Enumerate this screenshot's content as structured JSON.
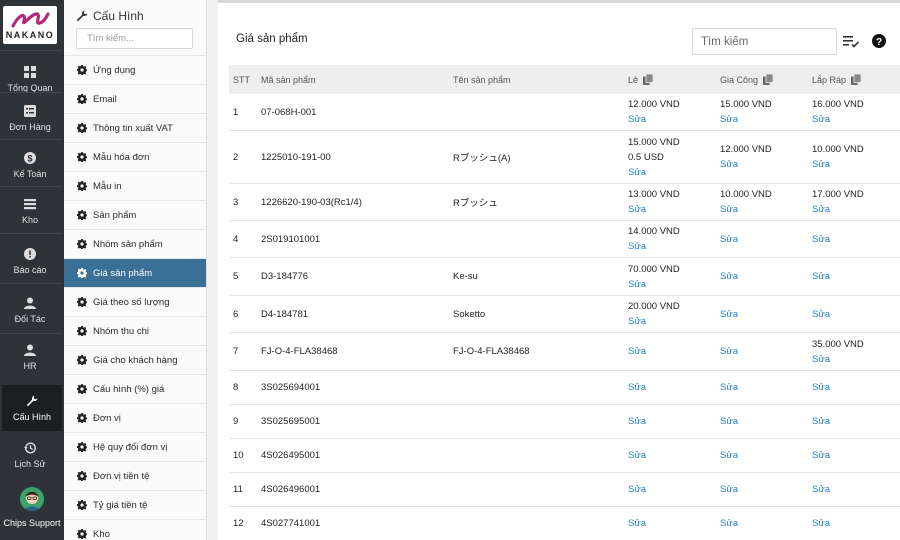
{
  "brand": {
    "logo_text": "NAKANO",
    "logo_color": "#b2287a"
  },
  "rail": [
    {
      "label": "Tổng Quan",
      "icon": "grid-icon"
    },
    {
      "label": "Đơn Hàng",
      "icon": "list-icon"
    },
    {
      "label": "Kế Toán",
      "icon": "dollar-icon"
    },
    {
      "label": "Kho",
      "icon": "stack-icon"
    },
    {
      "label": "Báo cáo",
      "icon": "alert-icon"
    },
    {
      "label": "Đối Tác",
      "icon": "person-icon"
    },
    {
      "label": "HR",
      "icon": "person-icon"
    },
    {
      "label": "Cấu Hình",
      "icon": "wrench-icon"
    },
    {
      "label": "Lịch Sử",
      "icon": "history-icon"
    }
  ],
  "chips": {
    "label": "Chips Support"
  },
  "sidebar": {
    "title": "Cấu Hình",
    "search_placeholder": "Tìm kiếm...",
    "items": [
      "Ứng dụng",
      "Email",
      "Thông tin xuất VAT",
      "Mẫu hóa đơn",
      "Mẫu in",
      "Sản phẩm",
      "Nhóm sản phẩm",
      "Giá sản phẩm",
      "Giá theo số lượng",
      "Nhóm thu chi",
      "Giá cho khách hàng",
      "Cấu hình (%) giá",
      "Đơn vị",
      "Hệ quy đổi đơn vị",
      "Đơn vị tiền tệ",
      "Tỷ giá tiền tệ",
      "Kho"
    ],
    "active_index": 7
  },
  "main": {
    "title": "Giá sản phẩm",
    "search_placeholder": "Tìm kiếm"
  },
  "table": {
    "headers": {
      "stt": "STT",
      "code": "Mã sản phẩm",
      "name": "Tên sản phẩm",
      "le": "Lẻ",
      "gc": "Gia Công",
      "lr": "Lắp Ráp"
    },
    "edit_label": "Sửa",
    "rows": [
      {
        "stt": "1",
        "code": "07-068H-001",
        "name": "",
        "le": [
          "12.000 VND"
        ],
        "gc": [
          "15.000 VND"
        ],
        "lr": [
          "16.000 VND"
        ]
      },
      {
        "stt": "2",
        "code": "1225010-191-00",
        "name": "Rブッシュ(A)",
        "le": [
          "15.000 VND",
          "0.5 USD"
        ],
        "gc": [
          "12.000 VND"
        ],
        "lr": [
          "10.000 VND"
        ]
      },
      {
        "stt": "3",
        "code": "1226620-190-03(Rc1/4)",
        "name": "Rブッシュ",
        "le": [
          "13.000 VND"
        ],
        "gc": [
          "10.000 VND"
        ],
        "lr": [
          "17.000 VND"
        ]
      },
      {
        "stt": "4",
        "code": "2S019101001",
        "name": "",
        "le": [
          "14.000 VND"
        ],
        "gc": [],
        "lr": []
      },
      {
        "stt": "5",
        "code": "D3-184776",
        "name": "Ke-su",
        "le": [
          "70.000 VND"
        ],
        "gc": [],
        "lr": []
      },
      {
        "stt": "6",
        "code": "D4-184781",
        "name": "Soketto",
        "le": [
          "20.000 VND"
        ],
        "gc": [],
        "lr": []
      },
      {
        "stt": "7",
        "code": "FJ-O-4-FLA38468",
        "name": "FJ-O-4-FLA38468",
        "le": [],
        "gc": [],
        "lr": [
          "35.000 VND"
        ]
      },
      {
        "stt": "8",
        "code": "3S025694001",
        "name": "",
        "le": [],
        "gc": [],
        "lr": []
      },
      {
        "stt": "9",
        "code": "3S025695001",
        "name": "",
        "le": [],
        "gc": [],
        "lr": []
      },
      {
        "stt": "10",
        "code": "4S026495001",
        "name": "",
        "le": [],
        "gc": [],
        "lr": []
      },
      {
        "stt": "11",
        "code": "4S026496001",
        "name": "",
        "le": [],
        "gc": [],
        "lr": []
      },
      {
        "stt": "12",
        "code": "4S027741001",
        "name": "",
        "le": [],
        "gc": [],
        "lr": []
      }
    ]
  }
}
